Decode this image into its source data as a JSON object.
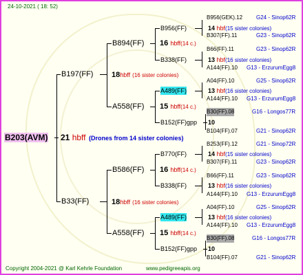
{
  "header": {
    "date": "24-10-2021 ( 18: 52)"
  },
  "footer": {
    "copyright": "Copyright 2004-2021 @ Karl Kehrle Foundation",
    "site": "www.pedigreeapis.org"
  },
  "root": {
    "name": "B203(AVM)",
    "gen": "21",
    "tag": "hbff",
    "note": "(Drones from 14 sister colonies)"
  },
  "gen1": [
    {
      "name": "B197(FF)",
      "gen": "18",
      "tag": "hbff",
      "note": "(16 sister colonies)"
    },
    {
      "name": "B33(FF)",
      "gen": "18",
      "tag": "hbff",
      "note": "(16 sister colonies)"
    }
  ],
  "gen2": [
    {
      "name": "B894(FF)",
      "gen": "16",
      "tag": "hbff",
      "note": "(14 c.)"
    },
    {
      "name": "A558(FF)",
      "gen": "15",
      "tag": "hbff",
      "note": "(14 c.)"
    },
    {
      "name": "B586(FF)",
      "gen": "16",
      "tag": "hbff",
      "note": "(14 c.)"
    },
    {
      "name": "A558(FF)",
      "gen": "15",
      "tag": "hbff",
      "note": "(14 c.)"
    }
  ],
  "gen3": [
    {
      "name": "B956(FF)",
      "gen": "14",
      "tag": "hbf",
      "note": "(15 sister colonies)"
    },
    {
      "name": "B338(FF)",
      "gen": "13",
      "tag": "hbf",
      "note": "(16 sister colonies)"
    },
    {
      "name": "A489(FF)",
      "gen": "13",
      "tag": "hbf",
      "note": "(16 sister colonies)"
    },
    {
      "name": "B152(FF)gpp",
      "gen": "10",
      "tag": "",
      "note": ""
    },
    {
      "name": "B770(FF)",
      "gen": "14",
      "tag": "hbf",
      "note": "(15 sister colonies)"
    },
    {
      "name": "B338(FF)",
      "gen": "13",
      "tag": "hbf",
      "note": "(16 sister colonies)"
    },
    {
      "name": "A489(FF)",
      "gen": "13",
      "tag": "hbf",
      "note": "(16 sister colonies)"
    },
    {
      "name": "B152(FF)gpp",
      "gen": "10",
      "tag": "",
      "note": ""
    }
  ],
  "gen4": [
    {
      "name": "B956(GEK).12",
      "info": "G24 - Sinop62R"
    },
    {
      "name": "B307(FF).11",
      "info": "G23 - Sinop62R"
    },
    {
      "name": "B66(FF).11",
      "info": "G23 - Sinop62R"
    },
    {
      "name": "A144(FF).10",
      "info": "G13 - ErzurumEgg8"
    },
    {
      "name": "A04(FF).10",
      "info": "G25 - Sinop62R"
    },
    {
      "name": "A144(FF).10",
      "info": "G13 - ErzurumEgg8"
    },
    {
      "name": "B30(FF).08",
      "info": "G16 - Longos77R"
    },
    {
      "name": "B104(FF).07",
      "info": "G21 - Sinop62R"
    },
    {
      "name": "B253(FF).12",
      "info": "G21 - Sinop72R"
    },
    {
      "name": "B307(FF).11",
      "info": "G23 - Sinop62R"
    },
    {
      "name": "B66(FF).11",
      "info": "G23 - Sinop62R"
    },
    {
      "name": "A144(FF).10",
      "info": "G13 - ErzurumEgg8"
    },
    {
      "name": "A04(FF).10",
      "info": "G25 - Sinop62R"
    },
    {
      "name": "A144(FF).10",
      "info": "G13 - ErzurumEgg8"
    },
    {
      "name": "B30(FF).08",
      "info": "G16 - Longos77R"
    },
    {
      "name": "B104(FF).07",
      "info": "G21 - Sinop62R"
    }
  ]
}
